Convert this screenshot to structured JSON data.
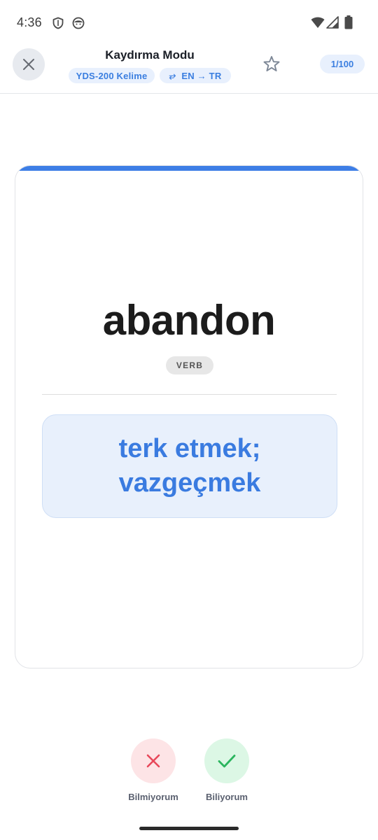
{
  "status_bar": {
    "time": "4:36",
    "icons": [
      "shield-icon",
      "face-icon",
      "wifi-icon",
      "signal-icon",
      "battery-icon"
    ]
  },
  "header": {
    "title": "Kaydırma Modu",
    "deck_chip": "YDS-200 Kelime",
    "direction_icon": "⥂",
    "direction_chip": "EN → TR",
    "counter": "1/100",
    "close_icon": "close-icon",
    "star_icon": "star-outline-icon"
  },
  "card": {
    "word": "abandon",
    "part_of_speech": "VERB",
    "translation": "terk etmek; vazgeçmek",
    "accent_color": "#3d7ee6"
  },
  "actions": {
    "unknown_label": "Bilmiyorum",
    "known_label": "Biliyorum",
    "unknown_color": "#e8485a",
    "known_color": "#2bb55e"
  },
  "colors": {
    "accent": "#3a7ee0",
    "chip_bg": "#e8f0fd"
  }
}
